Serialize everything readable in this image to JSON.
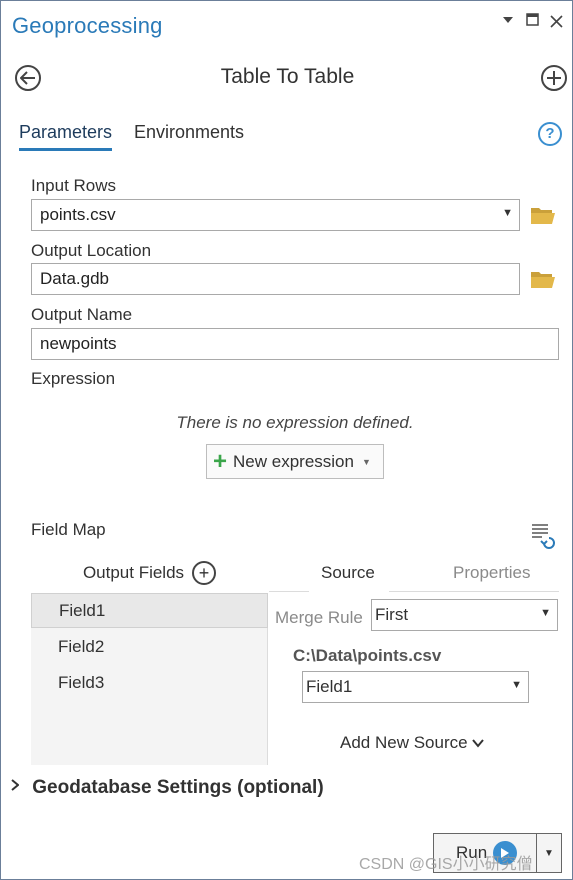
{
  "window": {
    "title": "Geoprocessing",
    "controls": [
      "chevron-down-icon",
      "restore-icon",
      "close-icon"
    ]
  },
  "tool": {
    "title": "Table To Table"
  },
  "tabs": {
    "parameters": "Parameters",
    "environments": "Environments"
  },
  "params": {
    "input_rows_label": "Input Rows",
    "input_rows_value": "points.csv",
    "output_location_label": "Output Location",
    "output_location_value": "Data.gdb",
    "output_name_label": "Output Name",
    "output_name_value": "newpoints",
    "expression_label": "Expression",
    "no_expression_text": "There is no expression defined.",
    "new_expression_label": "New expression"
  },
  "field_map": {
    "label": "Field Map",
    "output_fields_label": "Output Fields",
    "fields": [
      "Field1",
      "Field2",
      "Field3"
    ],
    "selected_field_index": 0,
    "source_tab": "Source",
    "properties_tab": "Properties",
    "merge_rule_label": "Merge Rule",
    "merge_rule_value": "First",
    "source_path": "C:\\Data\\points.csv",
    "source_field_value": "Field1",
    "add_new_source_label": "Add New Source"
  },
  "gdb_settings_label": "Geodatabase Settings (optional)",
  "run_label": "Run",
  "watermark": "CSDN @GIS小小研究僧",
  "colors": {
    "accent": "#2a7ab8",
    "folder": "#e3b84a",
    "add_green": "#3aa54a"
  }
}
